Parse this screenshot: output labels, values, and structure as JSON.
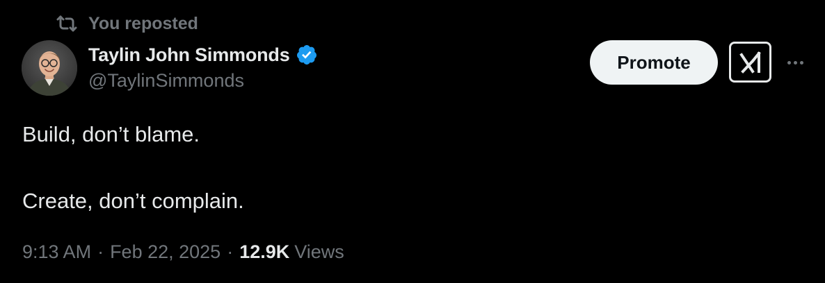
{
  "repost": {
    "icon": "repost-icon",
    "label": "You reposted"
  },
  "author": {
    "avatar": "avatar",
    "display_name": "Taylin John Simmonds",
    "handle": "@TaylinSimmonds",
    "verified_icon": "verified-badge-icon",
    "verified_color": "#1d9bf0"
  },
  "actions": {
    "promote_label": "Promote",
    "grok_icon": "grok-icon",
    "more_icon": "more-icon"
  },
  "tweet": {
    "lines": [
      "Build, don’t blame.",
      "Create, don’t complain."
    ]
  },
  "meta": {
    "time": "9:13 AM",
    "date": "Feb 22, 2025",
    "separator": "·",
    "views_count": "12.9K",
    "views_label": "Views"
  },
  "colors": {
    "background": "#000000",
    "text_primary": "#e7e9ea",
    "text_secondary": "#71767b",
    "button_bg": "#eff3f4",
    "accent": "#1d9bf0"
  }
}
